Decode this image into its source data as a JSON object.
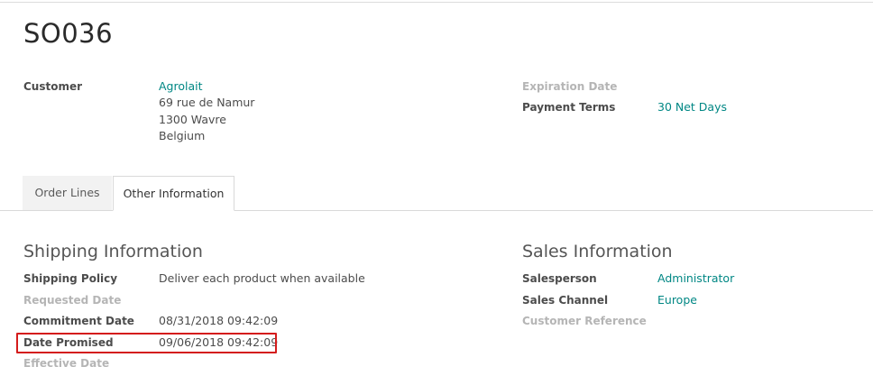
{
  "record": {
    "title": "SO036"
  },
  "customer": {
    "label": "Customer",
    "name": "Agrolait",
    "address": [
      "69 rue de Namur",
      "1300 Wavre",
      "Belgium"
    ]
  },
  "expiration": {
    "label": "Expiration Date"
  },
  "payment_terms": {
    "label": "Payment Terms",
    "value": "30 Net Days"
  },
  "tabs": [
    {
      "label": "Order Lines",
      "active": false
    },
    {
      "label": "Other Information",
      "active": true
    }
  ],
  "shipping": {
    "title": "Shipping Information",
    "fields": [
      {
        "label": "Shipping Policy",
        "value": "Deliver each product when available"
      },
      {
        "label": "Requested Date",
        "value": ""
      },
      {
        "label": "Commitment Date",
        "value": "08/31/2018 09:42:09"
      },
      {
        "label": "Date Promised",
        "value": "09/06/2018 09:42:09"
      },
      {
        "label": "Effective Date",
        "value": ""
      }
    ]
  },
  "sales": {
    "title": "Sales Information",
    "fields": [
      {
        "label": "Salesperson",
        "value": "Administrator"
      },
      {
        "label": "Sales Channel",
        "value": "Europe"
      },
      {
        "label": "Customer Reference",
        "value": ""
      }
    ]
  },
  "colors": {
    "link": "#008784",
    "highlight": "#d41c1c",
    "muted_label": "#b5b5b5"
  }
}
